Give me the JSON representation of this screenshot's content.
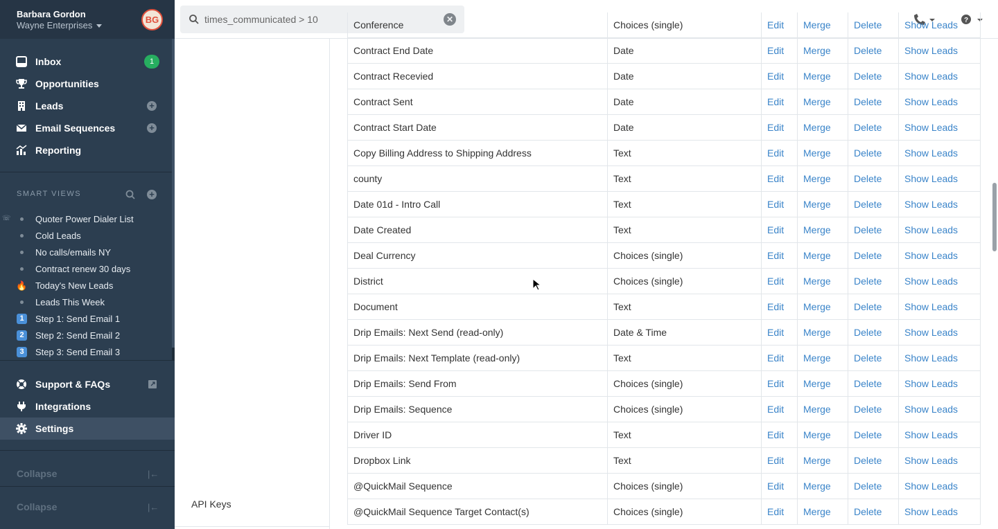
{
  "user": {
    "name": "Barbara Gordon",
    "org": "Wayne Enterprises",
    "initials": "BG"
  },
  "nav": {
    "inbox": {
      "label": "Inbox",
      "badge": "1"
    },
    "opportunities": {
      "label": "Opportunities"
    },
    "leads": {
      "label": "Leads"
    },
    "email_sequences": {
      "label": "Email Sequences"
    },
    "reporting": {
      "label": "Reporting"
    }
  },
  "smart_views": {
    "title": "SMART VIEWS",
    "items": [
      {
        "label": "Quoter Power Dialer List",
        "marker": "bullet",
        "suffix": "☏"
      },
      {
        "label": "Cold Leads",
        "marker": "bullet"
      },
      {
        "label": "No calls/emails NY",
        "marker": "bullet"
      },
      {
        "label": "Contract renew 30 days",
        "marker": "bullet"
      },
      {
        "label": "Today's New Leads",
        "marker": "fire"
      },
      {
        "label": "Leads This Week",
        "marker": "bullet"
      },
      {
        "label": "Step 1: Send Email 1",
        "marker": "1"
      },
      {
        "label": "Step 2: Send Email 2",
        "marker": "2"
      },
      {
        "label": "Step 3: Send Email 3",
        "marker": "3"
      }
    ]
  },
  "bottom_nav": {
    "support": {
      "label": "Support & FAQs"
    },
    "integrations": {
      "label": "Integrations"
    },
    "settings": {
      "label": "Settings"
    },
    "collapse1": "Collapse",
    "collapse2": "Collapse"
  },
  "search": {
    "value": "times_communicated > 10"
  },
  "midpane": {
    "api_keys": "API Keys"
  },
  "actions": {
    "edit": "Edit",
    "merge": "Merge",
    "delete": "Delete",
    "show_leads": "Show Leads"
  },
  "fields": [
    {
      "name": "Conference",
      "type": "Choices (single)"
    },
    {
      "name": "Contract End Date",
      "type": "Date"
    },
    {
      "name": "Contract Recevied",
      "type": "Date"
    },
    {
      "name": "Contract Sent",
      "type": "Date"
    },
    {
      "name": "Contract Start Date",
      "type": "Date"
    },
    {
      "name": "Copy Billing Address to Shipping Address",
      "type": "Text"
    },
    {
      "name": "county",
      "type": "Text"
    },
    {
      "name": "Date 01d - Intro Call",
      "type": "Text"
    },
    {
      "name": "Date Created",
      "type": "Text"
    },
    {
      "name": "Deal Currency",
      "type": "Choices (single)"
    },
    {
      "name": "District",
      "type": "Choices (single)"
    },
    {
      "name": "Document",
      "type": "Text"
    },
    {
      "name": "Drip Emails: Next Send (read-only)",
      "type": "Date & Time"
    },
    {
      "name": "Drip Emails: Next Template (read-only)",
      "type": "Text"
    },
    {
      "name": "Drip Emails: Send From",
      "type": "Choices (single)"
    },
    {
      "name": "Drip Emails: Sequence",
      "type": "Choices (single)"
    },
    {
      "name": "Driver ID",
      "type": "Text"
    },
    {
      "name": "Dropbox Link",
      "type": "Text"
    },
    {
      "name": "@QuickMail Sequence",
      "type": "Choices (single)"
    },
    {
      "name": "@QuickMail Sequence Target Contact(s)",
      "type": "Choices (single)"
    }
  ]
}
